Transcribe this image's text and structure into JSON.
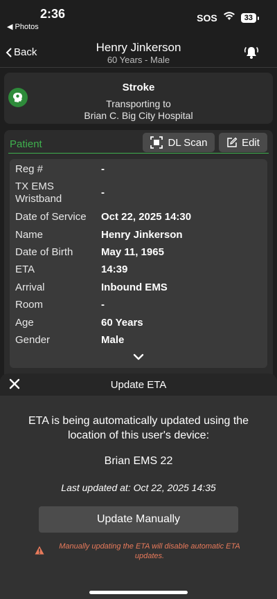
{
  "status_bar": {
    "time": "2:36",
    "back_app": "◀ Photos",
    "sos": "SOS",
    "battery": "33"
  },
  "nav": {
    "back_label": "Back",
    "title": "Henry Jinkerson",
    "subtitle": "60 Years - Male"
  },
  "destination": {
    "condition": "Stroke",
    "line1": "Transporting to",
    "line2": "Brian C. Big City Hospital"
  },
  "patient": {
    "section_label": "Patient",
    "dl_scan_label": "DL Scan",
    "edit_label": "Edit",
    "fields": [
      {
        "label": "Reg #",
        "value": "-"
      },
      {
        "label": "TX EMS Wristband",
        "value": "-"
      },
      {
        "label": "Date of Service",
        "value": "Oct 22, 2025 14:30"
      },
      {
        "label": "Name",
        "value": "Henry Jinkerson"
      },
      {
        "label": "Date of Birth",
        "value": "May 11, 1965"
      },
      {
        "label": "ETA",
        "value": "14:39"
      },
      {
        "label": "Arrival",
        "value": "Inbound EMS"
      },
      {
        "label": "Room",
        "value": "-"
      },
      {
        "label": "Age",
        "value": "60 Years"
      },
      {
        "label": "Gender",
        "value": "Male"
      }
    ]
  },
  "eta_sheet": {
    "title": "Update ETA",
    "message": "ETA is being automatically updated using the location of this user's device:",
    "device": "Brian EMS 22",
    "last_updated": "Last updated at: Oct 22, 2025 14:35",
    "button_label": "Update Manually",
    "warning": "Manually updating the ETA will disable automatic ETA updates."
  },
  "colors": {
    "accent_green": "#3fb14e",
    "warning_orange": "#e87a5b",
    "background": "#1e1e1e"
  }
}
